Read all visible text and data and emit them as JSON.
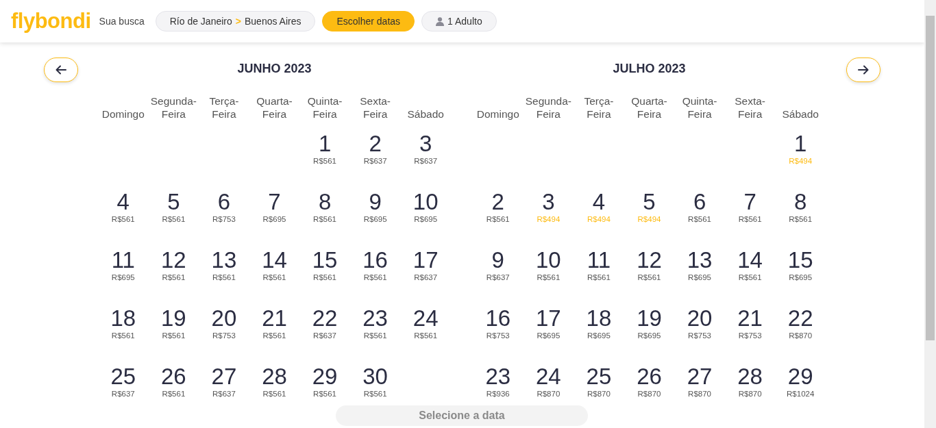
{
  "header": {
    "logo": "flybondi",
    "search_label": "Sua busca",
    "route": {
      "origin": "Río de Janeiro",
      "separator": ">",
      "destination": "Buenos Aires"
    },
    "dates_button": "Escolher datas",
    "passengers": "1 Adulto"
  },
  "months": [
    {
      "title": "JUNHO 2023",
      "weekdays": [
        "Domingo",
        "Segunda-Feira",
        "Terça-Feira",
        "Quarta-Feira",
        "Quinta-Feira",
        "Sexta-Feira",
        "Sábado"
      ],
      "weeks": [
        [
          {
            "day": "1",
            "price": "R$561",
            "cheapest": false
          },
          {
            "day": "2",
            "price": "R$637",
            "cheapest": false
          },
          {
            "day": "3",
            "price": "R$637",
            "cheapest": false
          }
        ],
        [
          {
            "day": "4",
            "price": "R$561",
            "cheapest": false
          },
          {
            "day": "5",
            "price": "R$561",
            "cheapest": false
          },
          {
            "day": "6",
            "price": "R$753",
            "cheapest": false
          },
          {
            "day": "7",
            "price": "R$695",
            "cheapest": false
          },
          {
            "day": "8",
            "price": "R$561",
            "cheapest": false
          },
          {
            "day": "9",
            "price": "R$695",
            "cheapest": false
          },
          {
            "day": "10",
            "price": "R$695",
            "cheapest": false
          }
        ],
        [
          {
            "day": "11",
            "price": "R$695",
            "cheapest": false
          },
          {
            "day": "12",
            "price": "R$561",
            "cheapest": false
          },
          {
            "day": "13",
            "price": "R$561",
            "cheapest": false
          },
          {
            "day": "14",
            "price": "R$561",
            "cheapest": false
          },
          {
            "day": "15",
            "price": "R$561",
            "cheapest": false
          },
          {
            "day": "16",
            "price": "R$561",
            "cheapest": false
          },
          {
            "day": "17",
            "price": "R$637",
            "cheapest": false
          }
        ],
        [
          {
            "day": "18",
            "price": "R$561",
            "cheapest": false
          },
          {
            "day": "19",
            "price": "R$561",
            "cheapest": false
          },
          {
            "day": "20",
            "price": "R$753",
            "cheapest": false
          },
          {
            "day": "21",
            "price": "R$561",
            "cheapest": false
          },
          {
            "day": "22",
            "price": "R$637",
            "cheapest": false
          },
          {
            "day": "23",
            "price": "R$561",
            "cheapest": false
          },
          {
            "day": "24",
            "price": "R$561",
            "cheapest": false
          }
        ],
        [
          {
            "day": "25",
            "price": "R$637",
            "cheapest": false
          },
          {
            "day": "26",
            "price": "R$561",
            "cheapest": false
          },
          {
            "day": "27",
            "price": "R$637",
            "cheapest": false
          },
          {
            "day": "28",
            "price": "R$561",
            "cheapest": false
          },
          {
            "day": "29",
            "price": "R$561",
            "cheapest": false
          },
          {
            "day": "30",
            "price": "R$561",
            "cheapest": false
          }
        ]
      ]
    },
    {
      "title": "JULHO 2023",
      "weekdays": [
        "Domingo",
        "Segunda-Feira",
        "Terça-Feira",
        "Quarta-Feira",
        "Quinta-Feira",
        "Sexta-Feira",
        "Sábado"
      ],
      "weeks": [
        [
          {
            "day": "1",
            "price": "R$494",
            "cheapest": true
          }
        ],
        [
          {
            "day": "2",
            "price": "R$561",
            "cheapest": false
          },
          {
            "day": "3",
            "price": "R$494",
            "cheapest": true
          },
          {
            "day": "4",
            "price": "R$494",
            "cheapest": true
          },
          {
            "day": "5",
            "price": "R$494",
            "cheapest": true
          },
          {
            "day": "6",
            "price": "R$561",
            "cheapest": false
          },
          {
            "day": "7",
            "price": "R$561",
            "cheapest": false
          },
          {
            "day": "8",
            "price": "R$561",
            "cheapest": false
          }
        ],
        [
          {
            "day": "9",
            "price": "R$637",
            "cheapest": false
          },
          {
            "day": "10",
            "price": "R$561",
            "cheapest": false
          },
          {
            "day": "11",
            "price": "R$561",
            "cheapest": false
          },
          {
            "day": "12",
            "price": "R$561",
            "cheapest": false
          },
          {
            "day": "13",
            "price": "R$695",
            "cheapest": false
          },
          {
            "day": "14",
            "price": "R$561",
            "cheapest": false
          },
          {
            "day": "15",
            "price": "R$695",
            "cheapest": false
          }
        ],
        [
          {
            "day": "16",
            "price": "R$753",
            "cheapest": false
          },
          {
            "day": "17",
            "price": "R$695",
            "cheapest": false
          },
          {
            "day": "18",
            "price": "R$695",
            "cheapest": false
          },
          {
            "day": "19",
            "price": "R$695",
            "cheapest": false
          },
          {
            "day": "20",
            "price": "R$753",
            "cheapest": false
          },
          {
            "day": "21",
            "price": "R$753",
            "cheapest": false
          },
          {
            "day": "22",
            "price": "R$870",
            "cheapest": false
          }
        ],
        [
          {
            "day": "23",
            "price": "R$936",
            "cheapest": false
          },
          {
            "day": "24",
            "price": "R$870",
            "cheapest": false
          },
          {
            "day": "25",
            "price": "R$870",
            "cheapest": false
          },
          {
            "day": "26",
            "price": "R$870",
            "cheapest": false
          },
          {
            "day": "27",
            "price": "R$870",
            "cheapest": false
          },
          {
            "day": "28",
            "price": "R$870",
            "cheapest": false
          },
          {
            "day": "29",
            "price": "R$1024",
            "cheapest": false
          }
        ]
      ]
    }
  ],
  "select_prompt": "Selecione a data"
}
